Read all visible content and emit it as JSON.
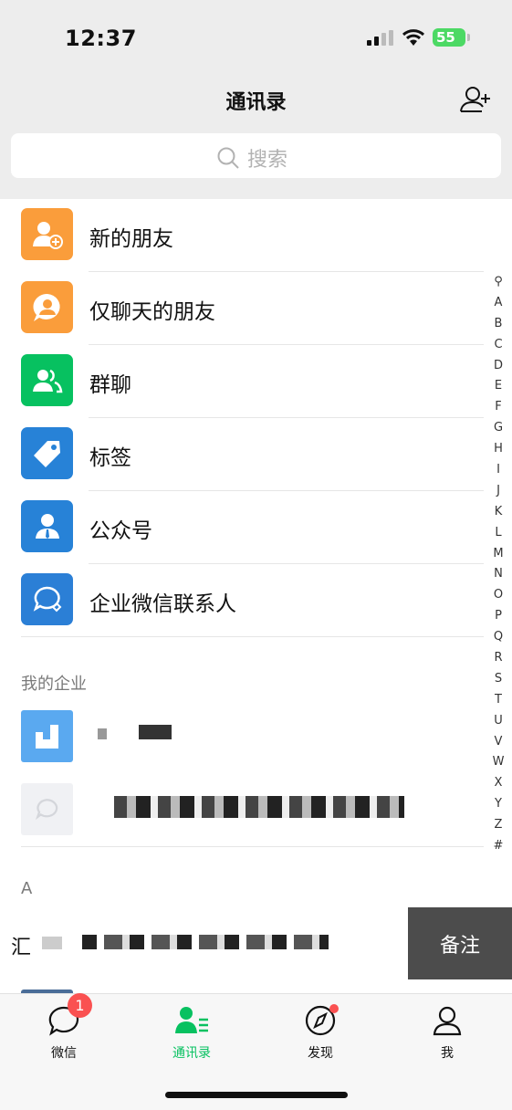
{
  "status": {
    "time": "12:37",
    "battery": "55"
  },
  "nav": {
    "title": "通讯录"
  },
  "search": {
    "placeholder": "搜索"
  },
  "entries": [
    {
      "label": "新的朋友",
      "icon": "new-friend-icon",
      "color": "#fa9d3b"
    },
    {
      "label": "仅聊天的朋友",
      "icon": "chat-only-friend-icon",
      "color": "#fa9d3b"
    },
    {
      "label": "群聊",
      "icon": "group-chat-icon",
      "color": "#07c160"
    },
    {
      "label": "标签",
      "icon": "tag-icon",
      "color": "#2782d7"
    },
    {
      "label": "公众号",
      "icon": "official-account-icon",
      "color": "#2782d7"
    },
    {
      "label": "企业微信联系人",
      "icon": "wecom-contact-icon",
      "color": "#2b7fd6"
    }
  ],
  "sections": {
    "my_company": "我的企业",
    "a": "A"
  },
  "contact_a": {
    "prefix": "汇"
  },
  "swipe_action": {
    "remark": "备注"
  },
  "index_letters": [
    "A",
    "B",
    "C",
    "D",
    "E",
    "F",
    "G",
    "H",
    "I",
    "J",
    "K",
    "L",
    "M",
    "N",
    "O",
    "P",
    "Q",
    "R",
    "S",
    "T",
    "U",
    "V",
    "W",
    "X",
    "Y",
    "Z",
    "#"
  ],
  "tabs": {
    "chats": "微信",
    "contacts": "通讯录",
    "discover": "发现",
    "me": "我"
  },
  "badge": "1",
  "colors": {
    "accent": "#07c160",
    "badge": "#fa5151"
  }
}
